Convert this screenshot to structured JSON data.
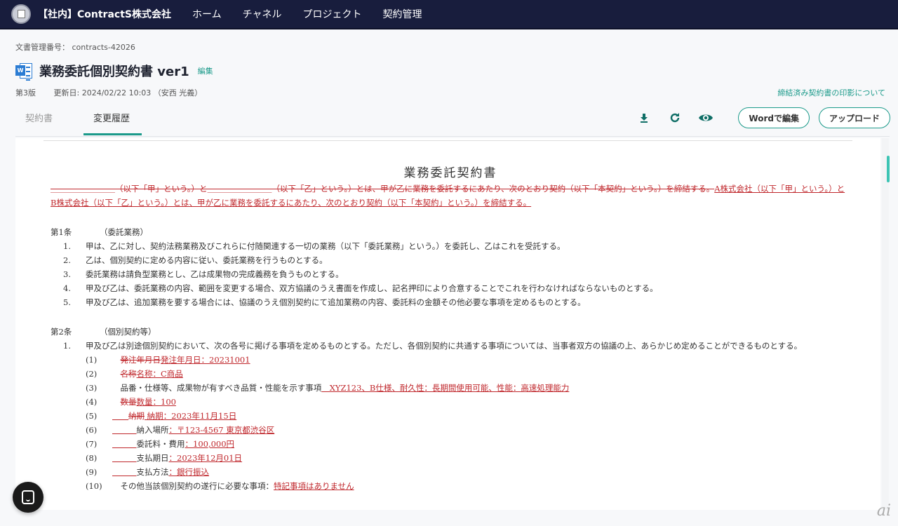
{
  "nav": {
    "org": "【社内】ContractS株式会社",
    "items": [
      "ホーム",
      "チャネル",
      "プロジェクト",
      "契約管理"
    ]
  },
  "doc_no": {
    "label": "文書管理番号：",
    "value": "contracts-42026"
  },
  "title": {
    "text": "業務委託個別契約書 ver1",
    "edit": "編集",
    "icon_letter": "W"
  },
  "meta": {
    "version": "第3版",
    "updated": "更新日: 2024/02/22 10:03 （安西 光義）"
  },
  "seal_link": "締結済み契約書の印影について",
  "tabs": [
    {
      "label": "契約書",
      "active": false
    },
    {
      "label": "変更履歴",
      "active": true
    }
  ],
  "toolbar": {
    "word_edit": "Wordで編集",
    "upload": "アップロード"
  },
  "colors": {
    "accent": "#1b9a8a",
    "navy": "#181d3d",
    "redline": "#c0282d"
  },
  "document": {
    "heading": "業務委託契約書",
    "preamble": [
      {
        "k": "del",
        "t": "＿＿＿＿＿＿＿＿（以下「甲」という。）と＿＿＿＿＿＿＿＿（以下「乙」という。）とは、甲が乙に業務を委託するにあたり、次のとおり契約（以下「本契約」という。）を締結する。"
      },
      {
        "k": "ins",
        "t": "A株式会社（以下「甲」という。）とB株式会社（以下「乙」という。）とは、甲が乙に業務を委託するにあたり、次のとおり契約（以下「本契約」という。）を締結する。"
      }
    ],
    "art1": {
      "num": "第1条",
      "title": "（委託業務）",
      "items": [
        "甲は、乙に対し、契約法務業務及びこれらに付随関連する一切の業務（以下「委託業務」という。）を委託し、乙はこれを受託する。",
        "乙は、個別契約に定める内容に従い、委託業務を行うものとする。",
        "委託業務は請負型業務とし、乙は成果物の完成義務を負うものとする。",
        "甲及び乙は、委託業務の内容、範囲を変更する場合、双方協議のうえ書面を作成し、記名押印により合意することでこれを行わなければならないものとする。",
        "甲及び乙は、追加業務を要する場合には、協議のうえ個別契約にて追加業務の内容、委託料の金額その他必要な事項を定めるものとする。"
      ]
    },
    "art2": {
      "num": "第2条",
      "title": "（個別契約等）",
      "item1": "甲及び乙は別途個別契約において、次の各号に掲げる事項を定めるものとする。ただし、各個別契約に共通する事項については、当事者双方の協議の上、あらかじめ定めることができるものとする。",
      "subs": [
        {
          "n": "(1)",
          "segs": [
            {
              "k": "n",
              "t": "　"
            },
            {
              "k": "del",
              "t": "発注年月日"
            },
            {
              "k": "ins",
              "t": "発注年月日：20231001"
            }
          ]
        },
        {
          "n": "(2)",
          "segs": [
            {
              "k": "n",
              "t": "　"
            },
            {
              "k": "del",
              "t": "名称"
            },
            {
              "k": "ins",
              "t": "名称：C商品"
            }
          ]
        },
        {
          "n": "(3)",
          "segs": [
            {
              "k": "n",
              "t": "　品番・仕様等、成果物が有すべき品質・性能を示す事項"
            },
            {
              "k": "ins",
              "t": "　XYZ123、B仕様、耐久性：長期間使用可能、性能：高速処理能力"
            }
          ]
        },
        {
          "n": "(4)",
          "segs": [
            {
              "k": "n",
              "t": "　"
            },
            {
              "k": "del",
              "t": "数量"
            },
            {
              "k": "ins",
              "t": "数量：100"
            }
          ]
        },
        {
          "n": "(5)",
          "segs": [
            {
              "k": "ins",
              "t": "＿＿"
            },
            {
              "k": "del",
              "t": "納期"
            },
            {
              "k": "ins",
              "t": " 納期：2023年11月15日"
            }
          ]
        },
        {
          "n": "(6)",
          "segs": [
            {
              "k": "ins",
              "t": "＿＿＿"
            },
            {
              "k": "n",
              "t": "納入場所"
            },
            {
              "k": "ins",
              "t": "：〒123-4567 東京都渋谷区"
            }
          ]
        },
        {
          "n": "(7)",
          "segs": [
            {
              "k": "ins",
              "t": "＿＿＿"
            },
            {
              "k": "n",
              "t": "委託料・費用"
            },
            {
              "k": "ins",
              "t": "：100,000円"
            }
          ]
        },
        {
          "n": "(8)",
          "segs": [
            {
              "k": "ins",
              "t": "＿＿＿"
            },
            {
              "k": "n",
              "t": "支払期日"
            },
            {
              "k": "ins",
              "t": "：2023年12月01日"
            }
          ]
        },
        {
          "n": "(9)",
          "segs": [
            {
              "k": "ins",
              "t": "＿＿＿"
            },
            {
              "k": "n",
              "t": "支払方法"
            },
            {
              "k": "ins",
              "t": "：銀行振込"
            }
          ]
        },
        {
          "n": "(10)",
          "segs": [
            {
              "k": "n",
              "t": "　その他当該個別契約の遂行に必要な事項："
            },
            {
              "k": "ins",
              "t": "特記事項はありません"
            }
          ]
        }
      ]
    }
  },
  "watermark": "ai"
}
